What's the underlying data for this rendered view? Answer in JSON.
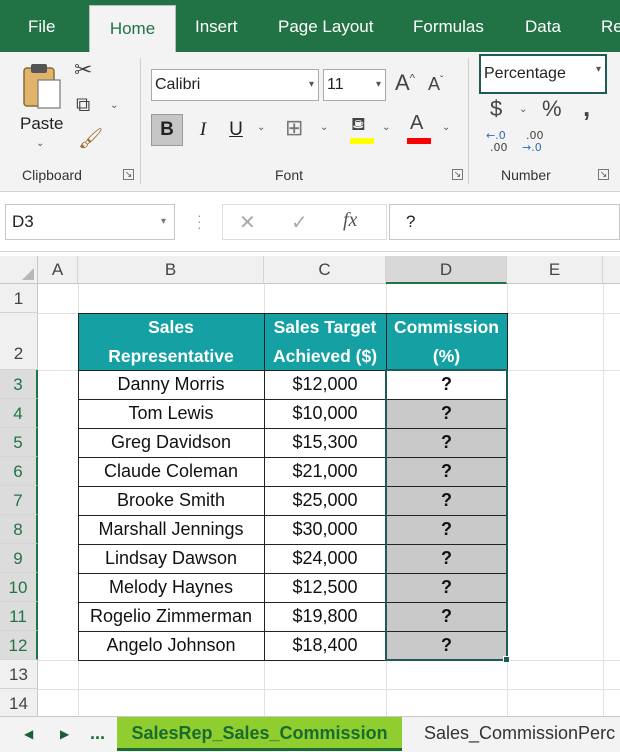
{
  "ribbon_tabs": [
    "File",
    "Home",
    "Insert",
    "Page Layout",
    "Formulas",
    "Data",
    "Re"
  ],
  "clipboard": {
    "paste_label": "Paste",
    "group_label": "Clipboard"
  },
  "font": {
    "name": "Calibri",
    "size": "11",
    "group_label": "Font",
    "bold": "B",
    "italic": "I",
    "underline": "U",
    "grow": "A",
    "shrink": "A",
    "fill_color": "#ffff00",
    "font_color": "#ff0000"
  },
  "number": {
    "format": "Percentage",
    "group_label": "Number",
    "currency": "$",
    "percent": "%",
    "comma": ",",
    "inc_decimal_top": "←.0",
    "inc_decimal_bot": ".00",
    "dec_decimal_top": ".00",
    "dec_decimal_bot": "→.0"
  },
  "formula_bar": {
    "name_box": "D3",
    "content": "?",
    "cancel": "✕",
    "enter": "✓",
    "fx": "fx"
  },
  "columns": [
    "A",
    "B",
    "C",
    "D",
    "E"
  ],
  "rows": [
    "1",
    "2",
    "3",
    "4",
    "5",
    "6",
    "7",
    "8",
    "9",
    "10",
    "11",
    "12",
    "13",
    "14"
  ],
  "table": {
    "headers": [
      [
        "Sales",
        "Representative"
      ],
      [
        "Sales Target",
        "Achieved ($)"
      ],
      [
        "Commission",
        "(%)"
      ]
    ],
    "header_color": "#15a0a3",
    "rows": [
      [
        "Danny Morris",
        "$12,000",
        "?"
      ],
      [
        "Tom Lewis",
        "$10,000",
        "?"
      ],
      [
        "Greg Davidson",
        "$15,300",
        "?"
      ],
      [
        "Claude Coleman",
        "$21,000",
        "?"
      ],
      [
        "Brooke Smith",
        "$25,000",
        "?"
      ],
      [
        "Marshall Jennings",
        "$30,000",
        "?"
      ],
      [
        "Lindsay Dawson",
        "$24,000",
        "?"
      ],
      [
        "Melody Haynes",
        "$12,500",
        "?"
      ],
      [
        "Rogelio Zimmerman",
        "$19,800",
        "?"
      ],
      [
        "Angelo Johnson",
        "$18,400",
        "?"
      ]
    ]
  },
  "sheet_tabs": {
    "ellipsis": "...",
    "active": "SalesRep_Sales_Commission",
    "next": "Sales_CommissionPerc"
  }
}
